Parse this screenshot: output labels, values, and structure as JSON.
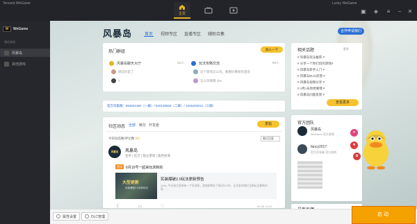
{
  "app": {
    "title": "Tencent WeGame",
    "user": "Lucky WeGame"
  },
  "topnav": {
    "home_label": "主页"
  },
  "sidebar": {
    "logo_text": "WeGame",
    "section_label": "我的游戏",
    "items": [
      {
        "label": "风暴岛"
      },
      {
        "label": "其他游戏"
      }
    ]
  },
  "community": {
    "logo": "风暴岛",
    "tabs": [
      "首页",
      "视频专区",
      "直播专区",
      "辅助合集"
    ],
    "apply_button": "合作申请我们"
  },
  "hot_groups": {
    "title": "热门群组",
    "join_button": "加入一下",
    "groups": [
      {
        "name": "风暴岛聊天大厅",
        "count": "33人",
        "last": "微信好友了"
      },
      {
        "name": "玩法攻略交流",
        "count": "59人",
        "last": "这个游戏怎么玩，看看好像很有意思"
      },
      {
        "name": "",
        "count": "",
        "last": "?"
      },
      {
        "name": "",
        "count": "",
        "last": "怎么玩啊哦 zhe"
      }
    ]
  },
  "notice": {
    "text": "官方玩家群：853631360（一群）/ 618135828（二群）/ 1045259012（三群）"
  },
  "feed": {
    "title": "社区动态",
    "tabs": [
      "全部",
      "精华",
      "开发者"
    ],
    "post_button": "发帖",
    "today_label": "今日动态数/评论数",
    "today_count": "0/2",
    "sort": "最近回复",
    "post": {
      "avatar_text": "风暴岛",
      "author": "风暴岛",
      "tags": "生存 | 社交 | 独立游戏 | 角色扮演",
      "badge": "置顶",
      "title": "6月15号一起来玩求新的",
      "thumb_title": "大型更新",
      "thumb_sub": "实装爆破2.0全新玩法",
      "headline": "实装爆破2.0玩法更新预告",
      "excerpt": "Hello, 今天给大家带来一个好消息，游戏即将在下周6月15号，正式发布我们全新玩法更新内容……",
      "time": "06-08 14:10"
    }
  },
  "topics": {
    "title": "相关话题",
    "more": "更多",
    "items": [
      {
        "label": "# 风暴岛玩法推荐 #",
        "n": ""
      },
      {
        "label": "# 分享一个你们玩的游戏#",
        "n": ""
      },
      {
        "label": "# 风暴岛新手入门 #",
        "n": ""
      },
      {
        "label": "# 风暴岛BUG反馈 #",
        "n": ""
      },
      {
        "label": "# 风暴岛视频分享 #",
        "n": ""
      },
      {
        "label": "# 4月1号你想要哦 #",
        "n": ""
      },
      {
        "label": "# 风暴岛问题反馈 #",
        "n": ""
      }
    ],
    "more_button": "查看更多"
  },
  "team": {
    "title": "官方团队",
    "members": [
      {
        "name": "风暴岛",
        "sub": "WeGame 官方游戏"
      },
      {
        "name": "fancy2017",
        "sub": "官方开发者 官方游戏"
      }
    ]
  },
  "next_section": {
    "title": "最新反馈"
  },
  "bottom": {
    "settings": "属性设置",
    "dlc": "DLC管理",
    "launch": "启动"
  },
  "colors": {
    "accent": "#f6c22d",
    "link": "#2b6fd6",
    "launch": "#f5a100"
  }
}
